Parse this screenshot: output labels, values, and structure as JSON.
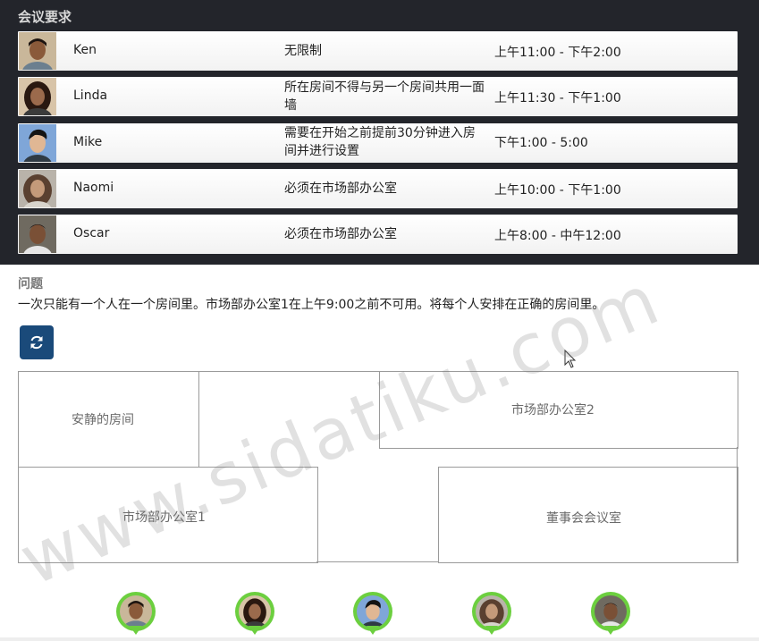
{
  "section_title": "会议要求",
  "requirements": [
    {
      "name": "Ken",
      "requirement": "无限制",
      "time": "上午11:00 - 下午2:00",
      "skin": "#8a5a3a",
      "hair": "#1d1410",
      "bg": "#c9b79a"
    },
    {
      "name": "Linda",
      "requirement": "所在房间不得与另一个房间共用一面墙",
      "time": "上午11:30 - 下午1:00",
      "skin": "#9b6a4c",
      "hair": "#2a1810",
      "bg": "#d8c4a8"
    },
    {
      "name": "Mike",
      "requirement": "需要在开始之前提前30分钟进入房间并进行设置",
      "time": "下午1:00 - 5:00",
      "skin": "#e0b794",
      "hair": "#141414",
      "bg": "#7fa6d8"
    },
    {
      "name": "Naomi",
      "requirement": "必须在市场部办公室",
      "time": "上午10:00 - 下午1:00",
      "skin": "#c49a7a",
      "hair": "#5a4030",
      "bg": "#b9b3aa"
    },
    {
      "name": "Oscar",
      "requirement": "必须在市场部办公室",
      "time": "上午8:00 - 中午12:00",
      "skin": "#7a5036",
      "hair": "#1a1210",
      "bg": "#6f6a60"
    }
  ],
  "question": {
    "title": "问题",
    "text": "一次只能有一个人在一个房间里。市场部办公室1在上午9:00之前不可用。将每个人安排在正确的房间里。"
  },
  "rooms": {
    "quiet": "安静的房间",
    "marketing2": "市场部办公室2",
    "marketing1": "市场部办公室1",
    "boardroom": "董事会会议室"
  },
  "watermark": "www.sidatiku.com"
}
